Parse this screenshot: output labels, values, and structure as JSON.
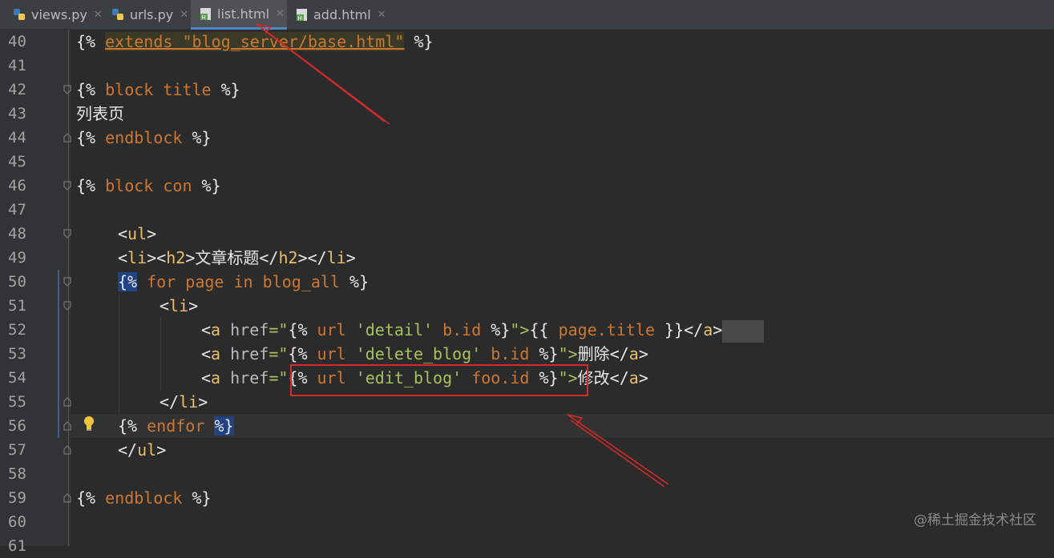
{
  "tabs": [
    {
      "label": "views.py",
      "type": "python",
      "active": false
    },
    {
      "label": "urls.py",
      "type": "python",
      "active": false
    },
    {
      "label": "list.html",
      "type": "html",
      "active": true
    },
    {
      "label": "add.html",
      "type": "html",
      "active": false
    }
  ],
  "line_numbers": [
    "40",
    "41",
    "42",
    "43",
    "44",
    "45",
    "46",
    "47",
    "48",
    "49",
    "50",
    "51",
    "52",
    "53",
    "54",
    "55",
    "56",
    "57",
    "58",
    "59",
    "60",
    "61"
  ],
  "code": {
    "l40": {
      "open": "{% ",
      "kw": "extends",
      "str": "\"blog_server/base.html\"",
      "close": " %}"
    },
    "l42": {
      "open": "{% ",
      "kw": "block title",
      "close": " %}"
    },
    "l43": {
      "text": "列表页"
    },
    "l44": {
      "open": "{% ",
      "kw": "endblock",
      "close": " %}"
    },
    "l46": {
      "open": "{% ",
      "kw": "block con",
      "close": " %}"
    },
    "l48": {
      "lt": "<",
      "tag": "ul",
      "gt": ">"
    },
    "l49": {
      "t1": "<",
      "tag1": "li",
      "t2": "><",
      "tag2": "h2",
      "t3": ">",
      "text": "文章标题",
      "t4": "</",
      "tag3": "h2",
      "t5": "></",
      "tag4": "li",
      "t6": ">"
    },
    "l50": {
      "open": "{%",
      "kw1": " for page ",
      "plain": "in",
      "kw2": " blog_all ",
      "close": "%}"
    },
    "l51": {
      "lt": "<",
      "tag": "li",
      "gt": ">"
    },
    "l52": {
      "lt": "<",
      "tag": "a",
      "attr": " href",
      "eq": "=\"",
      "t_open": "{% ",
      "kw": "url ",
      "str": "'detail'",
      "kw2": " b.id ",
      "t_close": "%}",
      "q": "\">",
      "v_open": "{{ ",
      "var": "page.title",
      "v_close": " }}",
      "end_lt": "</",
      "end_tag": "a",
      "end_gt": ">"
    },
    "l53": {
      "lt": "<",
      "tag": "a",
      "attr": " href",
      "eq": "=\"",
      "t_open": "{% ",
      "kw": "url ",
      "str": "'delete_blog'",
      "kw2": " b.id ",
      "t_close": "%}",
      "q": "\">",
      "text": "删除",
      "end_lt": "</",
      "end_tag": "a",
      "end_gt": ">"
    },
    "l54": {
      "lt": "<",
      "tag": "a",
      "attr": " href",
      "eq": "=\"",
      "t_open": "{% ",
      "kw": "url ",
      "str": "'edit_blog'",
      "kw2": " foo.id ",
      "t_close": "%}",
      "q": "\">",
      "text": "修改",
      "end_lt": "</",
      "end_tag": "a",
      "end_gt": ">"
    },
    "l55": {
      "lt": "</",
      "tag": "li",
      "gt": ">"
    },
    "l56": {
      "open": "{% ",
      "kw": "endfor ",
      "close": "%}"
    },
    "l57": {
      "lt": "</",
      "tag": "ul",
      "gt": ">"
    },
    "l59": {
      "open": "{% ",
      "kw": "endblock",
      "close": " %}"
    }
  },
  "watermark": "@稀土掘金技术社区",
  "colors": {
    "keyword": "#cc7832",
    "tag": "#e8bf6a",
    "string": "#a5c25c",
    "annotation": "#d32a2a",
    "selection": "#214283"
  }
}
